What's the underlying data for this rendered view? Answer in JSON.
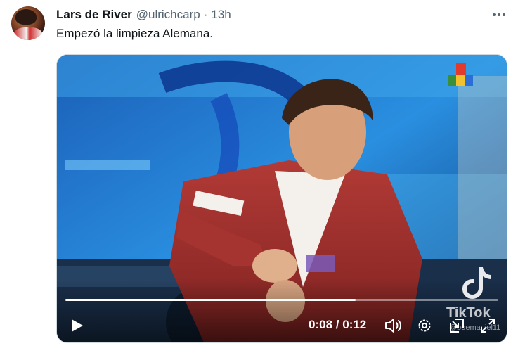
{
  "post": {
    "display_name": "Lars de River",
    "handle": "@ulrichcarp",
    "separator": "·",
    "time": "13h",
    "text": "Empezó la limpieza Alemana."
  },
  "media": {
    "current_time": "0:08",
    "duration": "0:12",
    "time_separator": "/",
    "progress": 0.67,
    "watermark": "TikTok",
    "watermark_handle": "@boemaniel11"
  },
  "icons": {
    "more": "more-dots-icon",
    "play": "play-icon",
    "volume": "volume-icon",
    "settings": "gear-icon",
    "pip": "picture-in-picture-icon",
    "fullscreen": "fullscreen-icon",
    "tiktok": "tiktok-logo-icon",
    "channel": "channel-logo-icon"
  },
  "colors": {
    "text": "#0f1419",
    "secondary": "#536471",
    "border": "#cfd9de"
  }
}
